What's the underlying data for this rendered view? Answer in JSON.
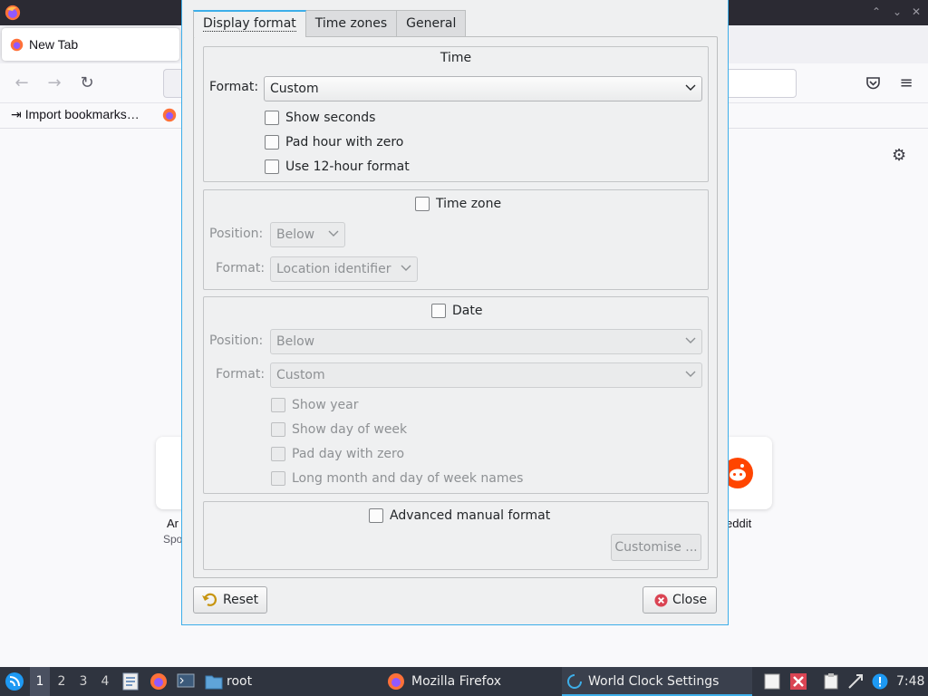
{
  "firefox": {
    "window_controls": [
      "⌃",
      "⌄",
      "✕"
    ],
    "tab_title": "New Tab",
    "bookmark_label": "Import bookmarks…",
    "shortcut_left_caption": "Ar",
    "shortcut_left_sub": "Spo",
    "shortcut_right_caption": "eddit"
  },
  "dialog": {
    "tabs": [
      "Display format",
      "Time zones",
      "General"
    ],
    "active_tab": "Display format",
    "time_group": {
      "title": "Time",
      "format_label": "Format:",
      "format_value": "Custom",
      "show_seconds": "Show seconds",
      "pad_hour": "Pad hour with zero",
      "use_12h": "Use 12-hour format"
    },
    "timezone_group": {
      "title": "Time zone",
      "position_label": "Position:",
      "position_value": "Below",
      "format_label": "Format:",
      "format_value": "Location identifier"
    },
    "date_group": {
      "title": "Date",
      "position_label": "Position:",
      "position_value": "Below",
      "format_label": "Format:",
      "format_value": "Custom",
      "show_year": "Show year",
      "show_dow": "Show day of week",
      "pad_day": "Pad day with zero",
      "long_names": "Long month and day of week names"
    },
    "advanced_group": {
      "title": "Advanced manual format",
      "customise_label": "Customise ..."
    },
    "reset_label": "Reset",
    "close_label": "Close"
  },
  "taskbar": {
    "desktops": [
      "1",
      "2",
      "3",
      "4"
    ],
    "active_desktop": "1",
    "folder_label": "root",
    "tasks": [
      "Mozilla Firefox",
      "World Clock Settings"
    ],
    "clock": "7:48"
  },
  "colors": {
    "accent": "#3daee9",
    "dialog_bg": "#eff0f1",
    "taskbar_bg": "#2f343f",
    "close_icon": "#da4453"
  }
}
